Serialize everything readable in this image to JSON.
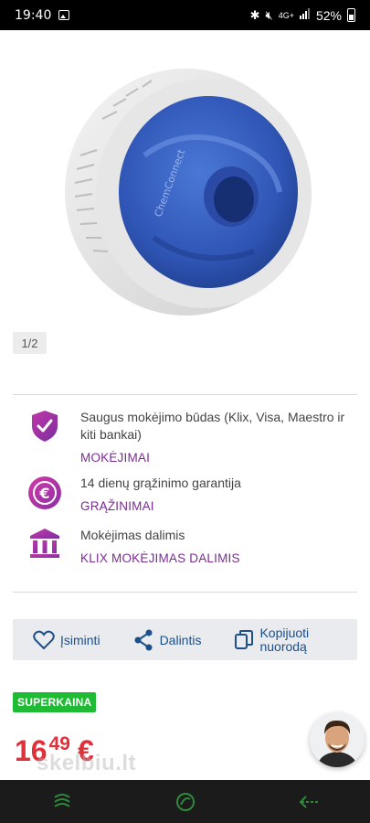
{
  "status_bar": {
    "time": "19:40",
    "indicators": "4G+",
    "battery": "52%"
  },
  "gallery": {
    "counter": "1/2",
    "product_label": "ChemConnect"
  },
  "benefits": [
    {
      "icon": "shield-check-icon",
      "text": "Saugus mokėjimo būdas (Klix, Visa, Maestro ir kiti bankai)",
      "link": "MOKĖJIMAI"
    },
    {
      "icon": "euro-refund-icon",
      "text": "14 dienų grąžinimo garantija",
      "link": "GRĄŽINIMAI"
    },
    {
      "icon": "bank-icon",
      "text": "Mokėjimas dalimis",
      "link": "KLIX MOKĖJIMAS DALIMIS"
    }
  ],
  "actions": {
    "remember": "Įsiminti",
    "share": "Dalintis",
    "copy_line1": "Kopijuoti",
    "copy_line2": "nuorodą"
  },
  "badge": "SUPERKAINA",
  "price": {
    "integer": "16",
    "decimal": "49",
    "currency": "€"
  },
  "watermark": "skelbiu.lt",
  "colors": {
    "accent_purple": "#7b2b95",
    "link_blue": "#1d4f88",
    "price_red": "#e0313b",
    "badge_green": "#1fbb35",
    "nav_green": "#2e8b3a"
  }
}
